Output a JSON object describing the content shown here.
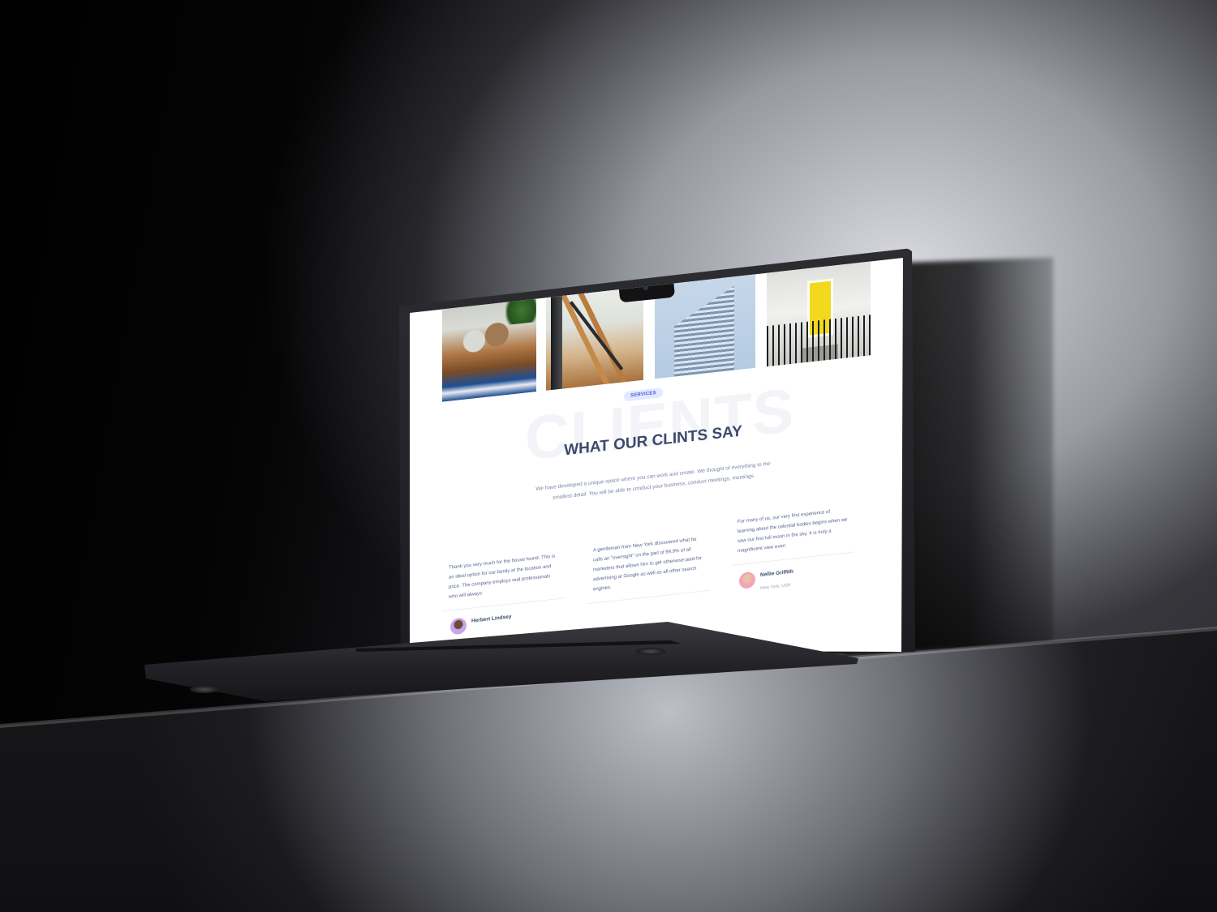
{
  "section": {
    "badge": "SERVICES",
    "background_word": "CLIENTS",
    "heading": "WHAT OUR CLINTS SAY",
    "intro": "We have developed a unique space where you can work and create. We thought of everything to the smallest detail. You will be able to conduct your business, conduct meetings, meetings"
  },
  "gallery": [
    {
      "subject": "living room coffee table"
    },
    {
      "subject": "wooden staircase"
    },
    {
      "subject": "glass tower building"
    },
    {
      "subject": "yellow front door"
    }
  ],
  "testimonials": [
    {
      "quote": "Thank you very much for the house found. This is an ideal option for our family at the location and price. The company employs real professionals who will always",
      "name": "Herbert Lindsey",
      "place": ""
    },
    {
      "quote": "A gentleman from New York discovered what he calls an \"oversight\" on the part of 99.9% of all marketers that allows him to get otherwise paid-for advertising at Google as well as all other search engines.",
      "name": "",
      "place": ""
    },
    {
      "quote": "For many of us, our very first experience of learning about the celestial bodies begins when we saw our first full moon in the sky. It is truly a magnificent view even",
      "name": "Nellie Griffith",
      "place": "New York, USA"
    }
  ],
  "colors": {
    "accent": "#3f5fe0",
    "badge_bg": "#e4e9ff",
    "heading": "#3c4a6b",
    "body_text": "#7a86a8",
    "door_yellow": "#f2d91e",
    "laptop": "#2a2a2f"
  }
}
